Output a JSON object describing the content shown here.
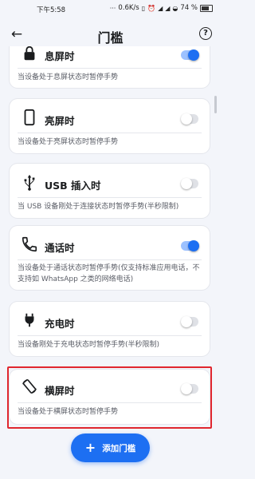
{
  "status_bar": {
    "time": "下午5:58",
    "net_speed": "0.6K/s",
    "battery": "74 %"
  },
  "app_bar": {
    "title": "门槛",
    "back_icon": "arrow-back-icon",
    "help_icon": "help-circle-icon"
  },
  "cards": [
    {
      "title": "息屏时",
      "desc": "当设备处于息屏状态时暂停手势",
      "icon": "lock-icon",
      "enabled": true
    },
    {
      "title": "亮屏时",
      "desc": "当设备处于亮屏状态时暂停手势",
      "icon": "phone-icon",
      "enabled": false
    },
    {
      "title": "USB 插入时",
      "desc": "当 USB 设备刚处于连接状态时暂停手势(半秒限制)",
      "icon": "usb-icon",
      "enabled": false
    },
    {
      "title": "通话时",
      "desc": "当设备处于通话状态时暂停手势(仅支持标准应用电话，不支持如 WhatsApp 之类的网络电话)",
      "icon": "phone-call-icon",
      "enabled": true
    },
    {
      "title": "充电时",
      "desc": "当设备刚处于充电状态时暂停手势(半秒限制)",
      "icon": "plug-icon",
      "enabled": false
    },
    {
      "title": "横屏时",
      "desc": "当设备处于横屏状态时暂停手势",
      "icon": "screen-rotation-icon",
      "enabled": false
    }
  ],
  "fab": {
    "label": "添加门槛",
    "icon": "plus-icon"
  },
  "colors": {
    "accent": "#1d6ff2",
    "highlight": "#e0262e",
    "background": "#f3f5fa"
  }
}
